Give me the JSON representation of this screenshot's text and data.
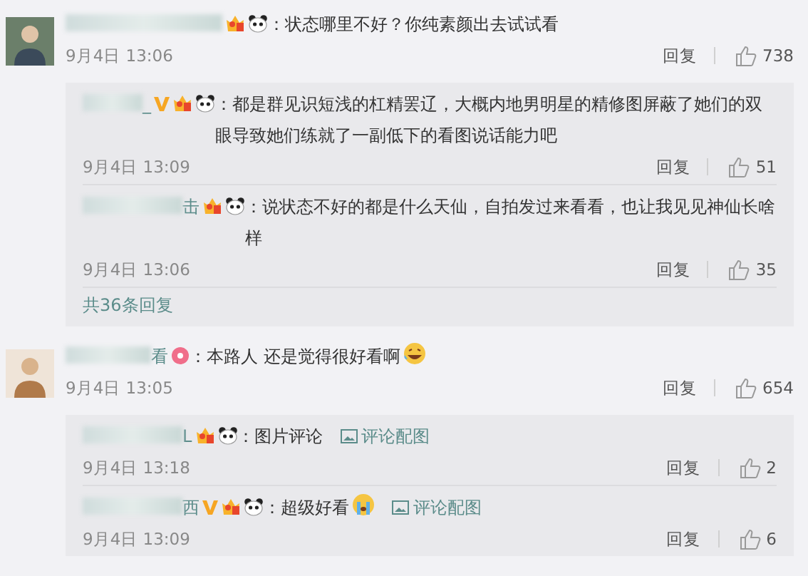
{
  "comments": [
    {
      "badges": [
        {
          "kind": "vip"
        },
        {
          "kind": "panda"
        }
      ],
      "text": "：状态哪里不好？你纯素颜出去试试看",
      "date": "9月4日 13:06",
      "reply_label": "回复",
      "likes": "738",
      "replies": [
        {
          "name_visible": "_",
          "badges": [
            {
              "kind": "v"
            },
            {
              "kind": "vip"
            },
            {
              "kind": "panda"
            }
          ],
          "text": "：都是群见识短浅的杠精罢辽，大概内地男明星的精修图屏蔽了她们的双眼导致她们练就了一副低下的看图说话能力吧",
          "date": "9月4日 13:09",
          "reply_label": "回复",
          "likes": "51"
        },
        {
          "name_visible": "击",
          "badges": [
            {
              "kind": "vip"
            },
            {
              "kind": "panda"
            }
          ],
          "text": "：说状态不好的都是什么天仙，自拍发过来看看，也让我见见神仙长啥样",
          "date": "9月4日 13:06",
          "reply_label": "回复",
          "likes": "35"
        }
      ],
      "more_replies": "共36条回复"
    },
    {
      "name_visible": "看",
      "badges": [
        {
          "kind": "donut"
        }
      ],
      "text": "：本路人 还是觉得很好看啊",
      "emoji": {
        "kind": "laugh"
      },
      "date": "9月4日 13:05",
      "reply_label": "回复",
      "likes": "654",
      "replies": [
        {
          "name_visible": "L",
          "badges": [
            {
              "kind": "vip"
            },
            {
              "kind": "panda"
            }
          ],
          "text": "：图片评论",
          "image_link": "评论配图",
          "date": "9月4日 13:18",
          "reply_label": "回复",
          "likes": "2"
        },
        {
          "name_visible": "西",
          "badges": [
            {
              "kind": "v"
            },
            {
              "kind": "vip"
            },
            {
              "kind": "panda"
            }
          ],
          "text": "：超级好看",
          "emoji": {
            "kind": "cry"
          },
          "image_link": "评论配图",
          "date": "9月4日 13:09",
          "reply_label": "回复",
          "likes": "6"
        }
      ]
    }
  ]
}
